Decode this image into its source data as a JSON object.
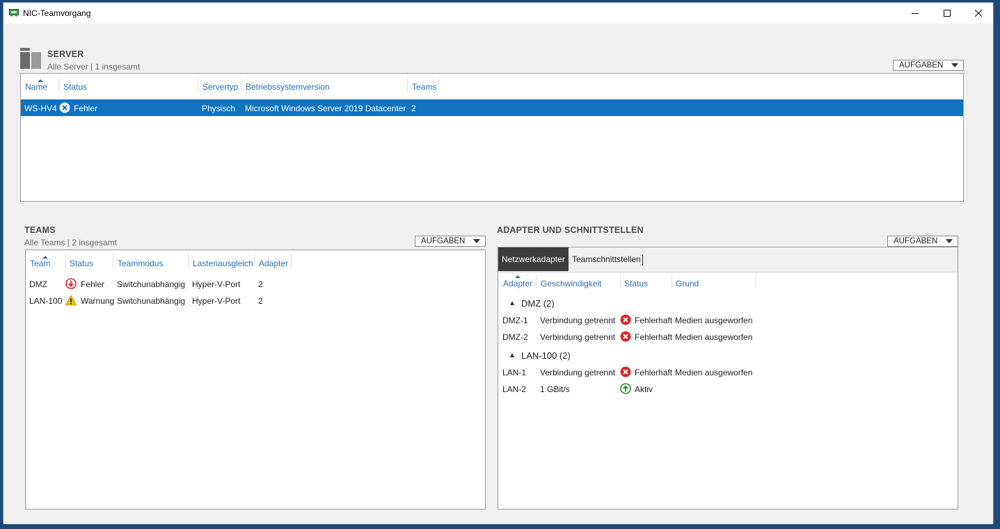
{
  "window": {
    "title": "NIC-Teamvorgang"
  },
  "server": {
    "title": "SERVER",
    "subtitle": "Alle Server | 1 insgesamt",
    "tasks_label": "AUFGABEN",
    "columns": [
      "Name",
      "Status",
      "Servertyp",
      "Betriebssystemversion",
      "Teams"
    ],
    "rows": [
      {
        "name": "WS-HV4",
        "status": "Fehler",
        "type": "Physisch",
        "os": "Microsoft Windows Server 2019 Datacenter",
        "teams": "2"
      }
    ]
  },
  "teams": {
    "title": "TEAMS",
    "subtitle": "Alle Teams | 2 insgesamt",
    "tasks_label": "AUFGABEN",
    "columns": [
      "Team",
      "Status",
      "Teammodus",
      "Lastenausgleich",
      "Adapter"
    ],
    "rows": [
      {
        "team": "DMZ",
        "status": "Fehler",
        "status_icon": "error-down-icon",
        "mode": "Switchunabhängig",
        "lb": "Hyper-V-Port",
        "adapters": "2"
      },
      {
        "team": "LAN-100",
        "status": "Warnung",
        "status_icon": "warning-icon",
        "mode": "Switchunabhängig",
        "lb": "Hyper-V-Port",
        "adapters": "2"
      }
    ]
  },
  "adapters": {
    "title": "ADAPTER UND SCHNITTSTELLEN",
    "tasks_label": "AUFGABEN",
    "tabs": [
      "Netzwerkadapter",
      "Teamschnittstellen"
    ],
    "columns": [
      "Adapter",
      "Geschwindigkeit",
      "Status",
      "Grund"
    ],
    "groups": [
      {
        "label": "DMZ (2)",
        "rows": [
          {
            "adapter": "DMZ-1",
            "speed": "Verbindung getrennt",
            "status": "Fehlerhaft",
            "reason": "Medien ausgeworfen"
          },
          {
            "adapter": "DMZ-2",
            "speed": "Verbindung getrennt",
            "status": "Fehlerhaft",
            "reason": "Medien ausgeworfen"
          }
        ]
      },
      {
        "label": "LAN-100 (2)",
        "rows": [
          {
            "adapter": "LAN-1",
            "speed": "Verbindung getrennt",
            "status": "Fehlerhaft",
            "reason": "Medien ausgeworfen"
          },
          {
            "adapter": "LAN-2",
            "speed": "1 GBit/s",
            "status": "Aktiv",
            "reason": ""
          }
        ]
      }
    ]
  },
  "colors": {
    "accent": "#0f73c2",
    "link": "#2b6db3",
    "error": "#d9242b",
    "warning": "#f5c400",
    "ok": "#2d8a2d"
  }
}
